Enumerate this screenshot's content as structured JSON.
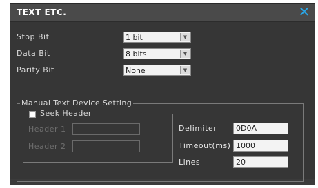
{
  "dialog": {
    "title": "TEXT ETC.",
    "close_icon": "close-x-icon",
    "accent_color": "#2aa7e8"
  },
  "serial": {
    "stop_bit": {
      "label": "Stop Bit",
      "value": "1 bit"
    },
    "data_bit": {
      "label": "Data Bit",
      "value": "8 bits"
    },
    "parity_bit": {
      "label": "Parity Bit",
      "value": "None"
    }
  },
  "manual": {
    "legend": "Manual Text Device Setting",
    "seek_header": {
      "label": "Seek Header",
      "checked": false,
      "header1_label": "Header 1",
      "header2_label": "Header 2",
      "header1_value": "",
      "header2_value": ""
    },
    "delimiter": {
      "label": "Delimiter",
      "value": "0D0A"
    },
    "timeout": {
      "label": "Timeout(ms)",
      "value": "1000"
    },
    "lines": {
      "label": "Lines",
      "value": "20"
    }
  }
}
